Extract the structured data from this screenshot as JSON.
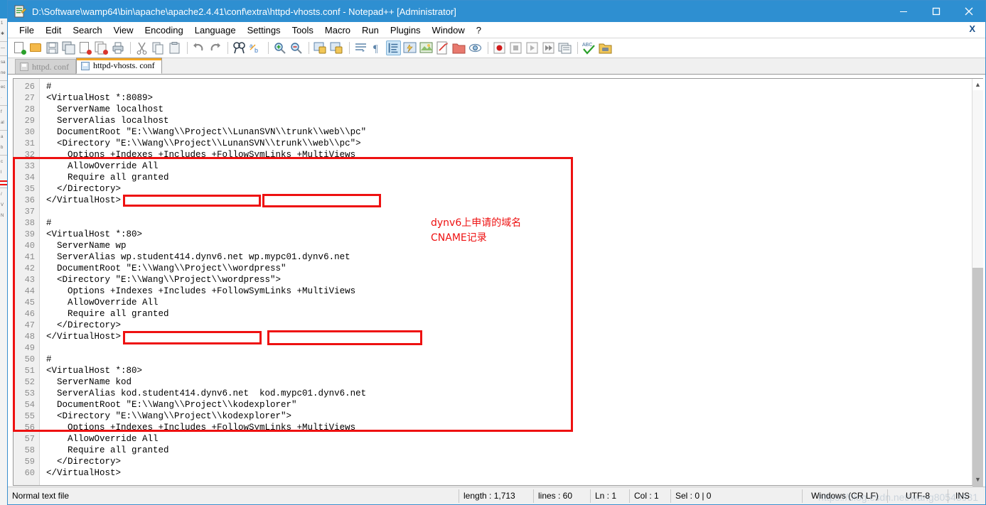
{
  "window": {
    "title": "D:\\Software\\wamp64\\bin\\apache\\apache2.4.41\\conf\\extra\\httpd-vhosts.conf - Notepad++ [Administrator]",
    "title_icon": "notepad-plus-plus-icon",
    "minimize_label": "—",
    "maximize_label": "□",
    "close_label": "✕",
    "titlebar_color": "#2e8fd1"
  },
  "menu": {
    "items": [
      {
        "label": "File"
      },
      {
        "label": "Edit"
      },
      {
        "label": "Search"
      },
      {
        "label": "View"
      },
      {
        "label": "Encoding"
      },
      {
        "label": "Language"
      },
      {
        "label": "Settings"
      },
      {
        "label": "Tools"
      },
      {
        "label": "Macro"
      },
      {
        "label": "Run"
      },
      {
        "label": "Plugins"
      },
      {
        "label": "Window"
      },
      {
        "label": "?"
      }
    ],
    "close_doc_label": "X"
  },
  "toolbar": {
    "icons": [
      "new-file-icon",
      "open-file-icon",
      "save-icon",
      "save-all-icon",
      "close-file-icon",
      "close-all-files-icon",
      "print-icon",
      "cut-icon",
      "copy-icon",
      "paste-icon",
      "undo-icon",
      "redo-icon",
      "find-icon",
      "replace-icon",
      "zoom-in-icon",
      "zoom-out-icon",
      "sync-vertical-scroll-icon",
      "sync-horizontal-scroll-icon",
      "word-wrap-icon",
      "show-all-characters-icon",
      "show-indent-guide-icon",
      "user-defined-dialog-icon",
      "document-map-icon",
      "function-list-icon",
      "folder-as-workspace-icon",
      "monitoring-icon",
      "record-macro-icon",
      "stop-recording-icon",
      "play-macro-icon",
      "run-macro-multiple-icon",
      "save-macro-icon",
      "spell-check-icon",
      "run-icon"
    ],
    "selected_icon": "show-indent-guide-icon"
  },
  "tabs": [
    {
      "label": "httpd. conf",
      "active": false
    },
    {
      "label": "httpd-vhosts. conf",
      "active": true
    }
  ],
  "editor": {
    "first_line_number": 26,
    "lines": [
      {
        "n": 26,
        "text": "#"
      },
      {
        "n": 27,
        "text": "<VirtualHost *:8089>"
      },
      {
        "n": 28,
        "text": "  ServerName localhost"
      },
      {
        "n": 29,
        "text": "  ServerAlias localhost"
      },
      {
        "n": 30,
        "text": "  DocumentRoot \"E:\\\\Wang\\\\Project\\\\LunanSVN\\\\trunk\\\\web\\\\pc\""
      },
      {
        "n": 31,
        "text": "  <Directory \"E:\\\\Wang\\\\Project\\\\LunanSVN\\\\trunk\\\\web\\\\pc\">"
      },
      {
        "n": 32,
        "text": "    Options +Indexes +Includes +FollowSymLinks +MultiViews"
      },
      {
        "n": 33,
        "text": "    AllowOverride All"
      },
      {
        "n": 34,
        "text": "    Require all granted"
      },
      {
        "n": 35,
        "text": "  </Directory>"
      },
      {
        "n": 36,
        "text": "</VirtualHost>"
      },
      {
        "n": 37,
        "text": ""
      },
      {
        "n": 38,
        "text": "#"
      },
      {
        "n": 39,
        "text": "<VirtualHost *:80>"
      },
      {
        "n": 40,
        "text": "  ServerName wp"
      },
      {
        "n": 41,
        "text": "  ServerAlias wp.student414.dynv6.net wp.mypc01.dynv6.net"
      },
      {
        "n": 42,
        "text": "  DocumentRoot \"E:\\\\Wang\\\\Project\\\\wordpress\""
      },
      {
        "n": 43,
        "text": "  <Directory \"E:\\\\Wang\\\\Project\\\\wordpress\">"
      },
      {
        "n": 44,
        "text": "    Options +Indexes +Includes +FollowSymLinks +MultiViews"
      },
      {
        "n": 45,
        "text": "    AllowOverride All"
      },
      {
        "n": 46,
        "text": "    Require all granted"
      },
      {
        "n": 47,
        "text": "  </Directory>"
      },
      {
        "n": 48,
        "text": "</VirtualHost>"
      },
      {
        "n": 49,
        "text": ""
      },
      {
        "n": 50,
        "text": "#"
      },
      {
        "n": 51,
        "text": "<VirtualHost *:80>"
      },
      {
        "n": 52,
        "text": "  ServerName kod"
      },
      {
        "n": 53,
        "text": "  ServerAlias kod.student414.dynv6.net  kod.mypc01.dynv6.net"
      },
      {
        "n": 54,
        "text": "  DocumentRoot \"E:\\\\Wang\\\\Project\\\\kodexplorer\""
      },
      {
        "n": 55,
        "text": "  <Directory \"E:\\\\Wang\\\\Project\\\\kodexplorer\">"
      },
      {
        "n": 56,
        "text": "    Options +Indexes +Includes +FollowSymLinks +MultiViews"
      },
      {
        "n": 57,
        "text": "    AllowOverride All"
      },
      {
        "n": 58,
        "text": "    Require all granted"
      },
      {
        "n": 59,
        "text": "  </Directory>"
      },
      {
        "n": 60,
        "text": "</VirtualHost>"
      }
    ]
  },
  "annotations": {
    "color": "#ee1111",
    "note_line_1": "dynv6上申请的域名",
    "note_line_2": "CNAME记录",
    "highlighted_values": [
      "wp.student414.dynv6.net",
      "wp.mypc01.dynv6.net",
      "kod.student414.dynv6.net",
      "kod.mypc01.dynv6.net"
    ]
  },
  "status_bar": {
    "file_type": "Normal text file",
    "length": "length : 1,713",
    "lines": "lines : 60",
    "ln": "Ln : 1",
    "col": "Col : 1",
    "sel": "Sel : 0 | 0",
    "eol": "Windows (CR LF)",
    "encoding": "UTF-8",
    "insert_mode": "INS",
    "watermark": "https://blog.csdn.net/wang80543931"
  }
}
